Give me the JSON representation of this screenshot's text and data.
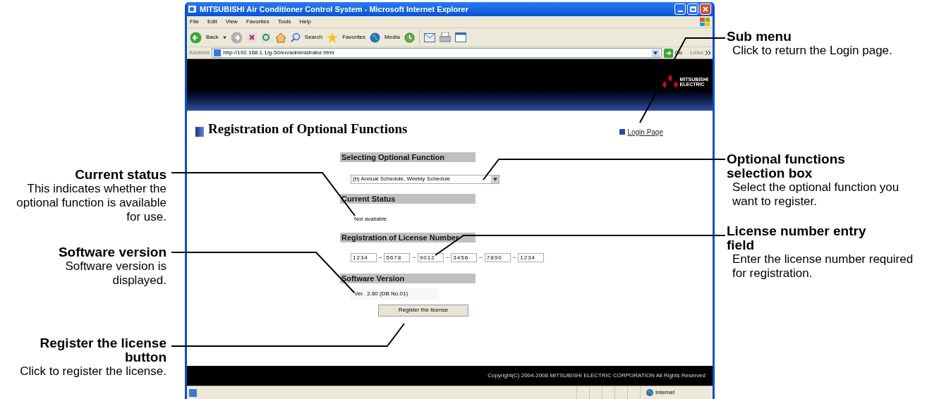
{
  "callouts_left": [
    {
      "title": "Current status",
      "description": "This indicates whether the optional function is available for use."
    },
    {
      "title": "Software version",
      "description": "Software version is displayed."
    },
    {
      "title": "Register the license button",
      "description": "Click to register the license."
    }
  ],
  "callouts_right": [
    {
      "title": "Sub menu",
      "description": "Click to return the Login page."
    },
    {
      "title": "Optional functions selection box",
      "description": "Select the optional function you want to register."
    },
    {
      "title": "License number entry field",
      "description": "Enter the license number required for registration."
    }
  ],
  "browser": {
    "title": "MITSUBISHI Air Conditioner Control System - Microsoft Internet Explorer",
    "menu": [
      "File",
      "Edit",
      "View",
      "Favorites",
      "Tools",
      "Help"
    ],
    "toolbar_labels": [
      "Back",
      "Search",
      "Favorites",
      "Media"
    ],
    "address_label": "Address",
    "url": "http://192.168.1.1/g-50/en/administrator.html",
    "go": "Go",
    "links": "Links"
  },
  "page": {
    "logo": [
      "MITSUBISHI",
      "ELECTRIC"
    ],
    "title": "Registration of Optional Functions",
    "submenu_link": "Login Page",
    "selecting_header": "Selecting Optional Function",
    "selected_function": "(b) Annual Schedule, Weekly Schedule",
    "status_header": "Current Status",
    "status": "Not available",
    "license_header": "Registration of License Number",
    "license_parts": [
      {
        "value": "1234"
      },
      {
        "separator": "–",
        "value": "5678"
      },
      {
        "separator": "–",
        "value": "9012"
      },
      {
        "separator": "–",
        "value": "3456"
      },
      {
        "separator": "–",
        "value": "7890"
      },
      {
        "separator": "–",
        "value": "1234"
      }
    ],
    "version_header": "Software Version",
    "version": "Ver.  2.60 (DB No.01)",
    "register_button": "Register the license",
    "footer": "Copyright(C) 2004-2008 MITSUBISHI ELECTRIC CORPORATION All Rights Reserved"
  },
  "status_bar": {
    "zone": "Internet"
  }
}
